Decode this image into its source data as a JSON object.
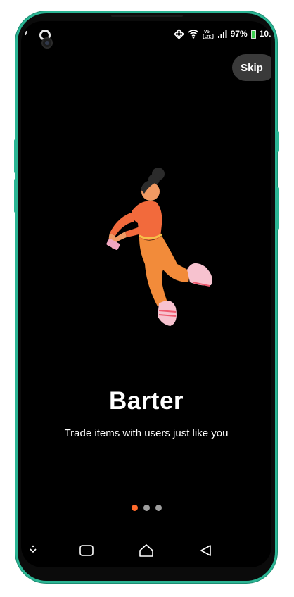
{
  "status_bar": {
    "battery": "97%",
    "time": "10:",
    "volte_label": "Vo LTE"
  },
  "onboarding": {
    "skip_label": "Skip",
    "title": "Barter",
    "subtitle": "Trade items with users just like you",
    "page_count": 3,
    "current_page": 1
  },
  "colors": {
    "background": "#000000",
    "accent": "#ff6a2b",
    "inactive_dot": "#9e9e9e",
    "skip_button": "#3a3a3a",
    "frame": "#2bb594"
  },
  "icons": {
    "status": [
      "notification-icon",
      "sync-icon",
      "wifi-icon",
      "volte-icon",
      "signal-icon",
      "battery-icon"
    ],
    "nav": [
      "keyboard-hide-icon",
      "recents-icon",
      "home-icon",
      "back-icon"
    ]
  }
}
